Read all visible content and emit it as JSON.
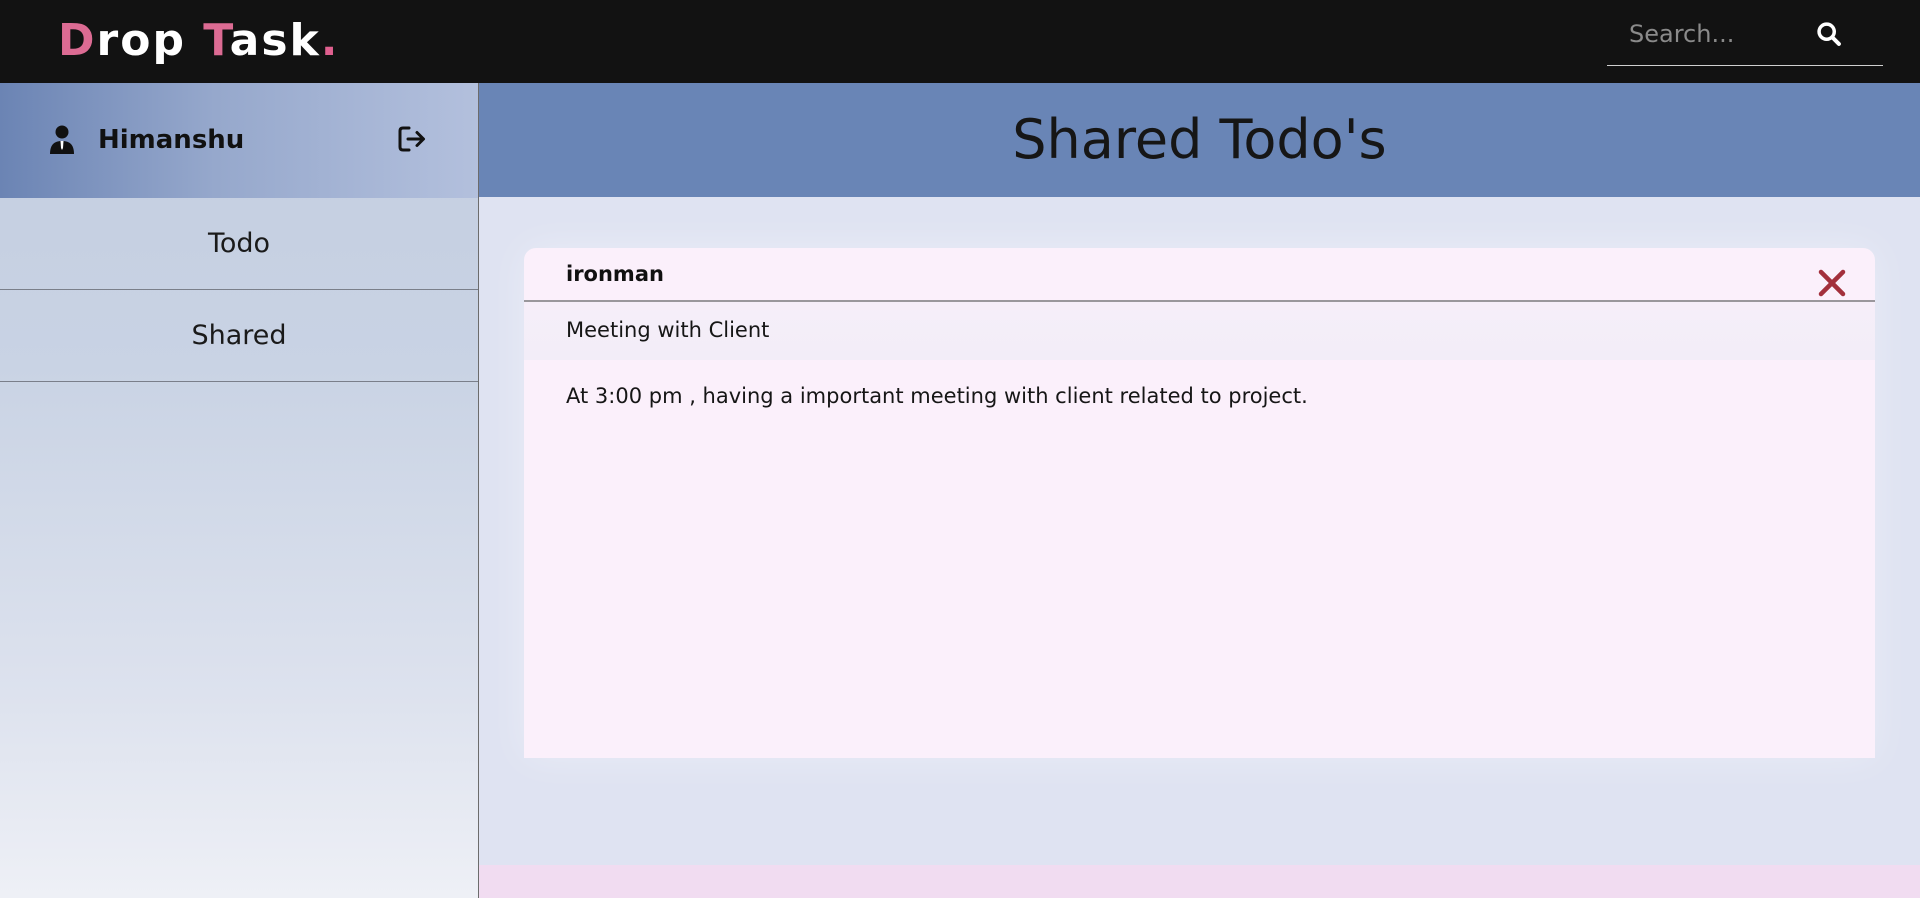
{
  "app": {
    "logo": {
      "d": "D",
      "rop": "rop ",
      "t": "T",
      "ask": "ask",
      "dot": "."
    },
    "colors": {
      "logo_accent": "#dc6b93",
      "navbar": "#121212",
      "header": "#6985b6",
      "close": "#a3303c"
    }
  },
  "search": {
    "placeholder": "Search...",
    "icon": "search-icon"
  },
  "sidebar": {
    "user": {
      "name": "Himanshu",
      "icon": "user-icon",
      "logout_icon": "logout-icon"
    },
    "items": [
      {
        "label": "Todo"
      },
      {
        "label": "Shared"
      }
    ]
  },
  "main": {
    "title": "Shared Todo's",
    "todos": [
      {
        "owner": "ironman",
        "title": "Meeting with Client",
        "description": "At 3:00 pm , having a important meeting with client related to project.",
        "delete_icon": "close-icon"
      }
    ]
  }
}
